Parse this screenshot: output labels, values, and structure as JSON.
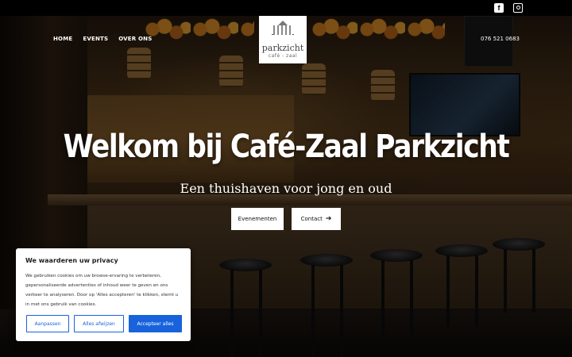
{
  "site": {
    "logo_name": "parkzicht",
    "logo_sub": "café - zaal"
  },
  "topbar": {
    "icons": [
      "facebook-icon",
      "instagram-icon"
    ]
  },
  "nav": {
    "items": [
      {
        "label": "HOME"
      },
      {
        "label": "EVENTS"
      },
      {
        "label": "OVER ONS"
      }
    ],
    "phone": "076 521 0683"
  },
  "hero": {
    "title": "Welkom bij Café-Zaal Parkzicht",
    "subtitle": "Een thuishaven voor jong en oud",
    "buttons": {
      "events": "Evenementen",
      "contact": "Contact",
      "contact_arrow": "➔"
    }
  },
  "cookie": {
    "title": "We waarderen uw privacy",
    "text": "We gebruiken cookies om uw browse-ervaring te verbeteren, gepersonaliseerde advertenties of inhoud weer te geven en ons verkeer te analyseren. Door op 'Alles accepteren' te klikken, stemt u in met ons gebruik van cookies.",
    "buttons": {
      "customize": "Aanpassen",
      "reject": "Alles afwijzen",
      "accept": "Accepteer alles"
    },
    "accent_color": "#1863dc"
  }
}
